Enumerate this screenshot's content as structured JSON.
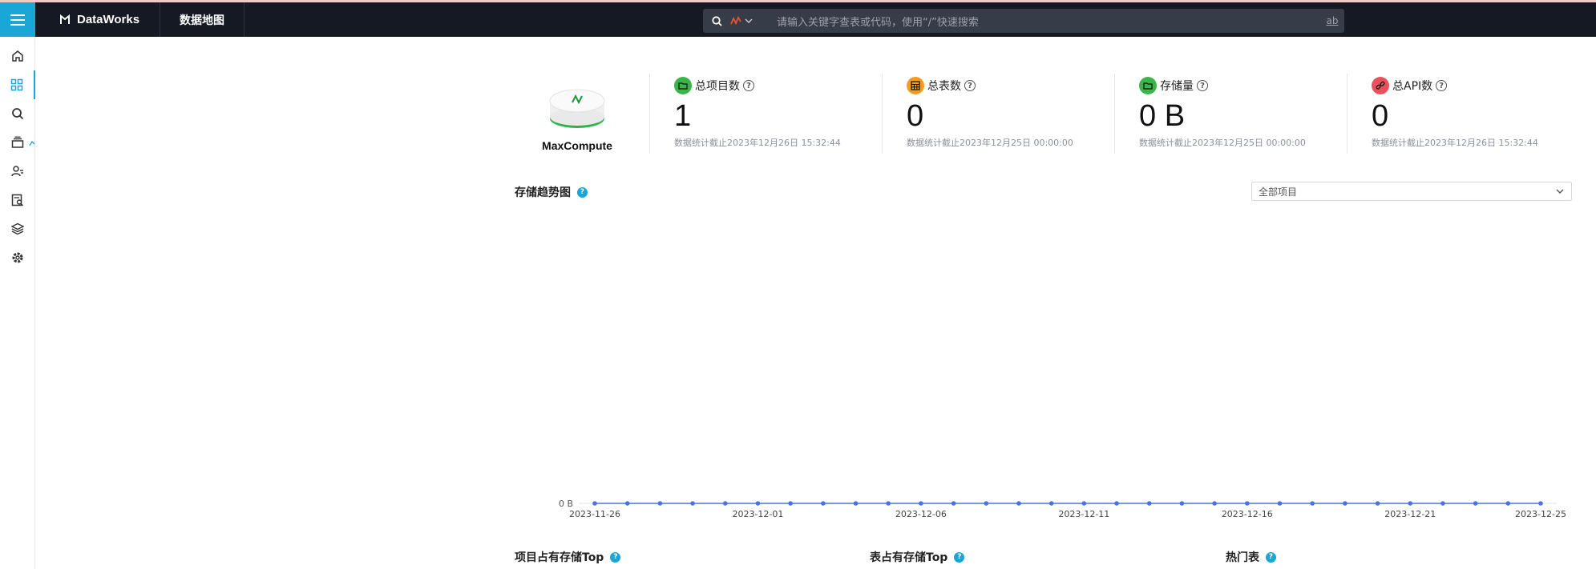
{
  "topbar": {
    "brand": "DataWorks",
    "module": "数据地图",
    "search_placeholder": "请输入关键字查表或代码，使用“/”快速搜索",
    "search_mode_label": "ab"
  },
  "sidebar": {
    "items": [
      {
        "icon": "home-icon"
      },
      {
        "icon": "grid-icon",
        "active": true
      },
      {
        "icon": "search-icon"
      },
      {
        "icon": "layers-icon"
      },
      {
        "icon": "user-list-icon"
      },
      {
        "icon": "table-search-icon"
      },
      {
        "icon": "stack-icon"
      },
      {
        "icon": "gear-icon"
      }
    ]
  },
  "engine": {
    "name": "MaxCompute"
  },
  "stats": [
    {
      "label": "总项目数",
      "value": "1",
      "note": "数据统计截止2023年12月26日 15:32:44",
      "color": "#3bb54a"
    },
    {
      "label": "总表数",
      "value": "0",
      "note": "数据统计截止2023年12月25日 00:00:00",
      "color": "#f39c1f"
    },
    {
      "label": "存储量",
      "value": "0 B",
      "note": "数据统计截止2023年12月25日 00:00:00",
      "color": "#3bb54a"
    },
    {
      "label": "总API数",
      "value": "0",
      "note": "数据统计截止2023年12月26日 15:32:44",
      "color": "#e9505c"
    }
  ],
  "trend": {
    "title": "存储趋势图",
    "project_select": "全部项目"
  },
  "chart_data": {
    "type": "line",
    "x": [
      "2023-11-26",
      "2023-11-27",
      "2023-11-28",
      "2023-11-29",
      "2023-11-30",
      "2023-12-01",
      "2023-12-02",
      "2023-12-03",
      "2023-12-04",
      "2023-12-05",
      "2023-12-06",
      "2023-12-07",
      "2023-12-08",
      "2023-12-09",
      "2023-12-10",
      "2023-12-11",
      "2023-12-12",
      "2023-12-13",
      "2023-12-14",
      "2023-12-15",
      "2023-12-16",
      "2023-12-17",
      "2023-12-18",
      "2023-12-19",
      "2023-12-20",
      "2023-12-21",
      "2023-12-22",
      "2023-12-23",
      "2023-12-24",
      "2023-12-25"
    ],
    "values": [
      0,
      0,
      0,
      0,
      0,
      0,
      0,
      0,
      0,
      0,
      0,
      0,
      0,
      0,
      0,
      0,
      0,
      0,
      0,
      0,
      0,
      0,
      0,
      0,
      0,
      0,
      0,
      0,
      0,
      0
    ],
    "x_ticks": [
      "2023-11-26",
      "2023-12-01",
      "2023-12-06",
      "2023-12-11",
      "2023-12-16",
      "2023-12-21",
      "2023-12-25"
    ],
    "y_ticks": [
      "0 B"
    ],
    "color": "#4a72e8",
    "grid": false,
    "legend": "none"
  },
  "bottom": {
    "project_top": "项目占有存储Top",
    "table_top": "表占有存储Top",
    "hot_tables": "热门表"
  }
}
